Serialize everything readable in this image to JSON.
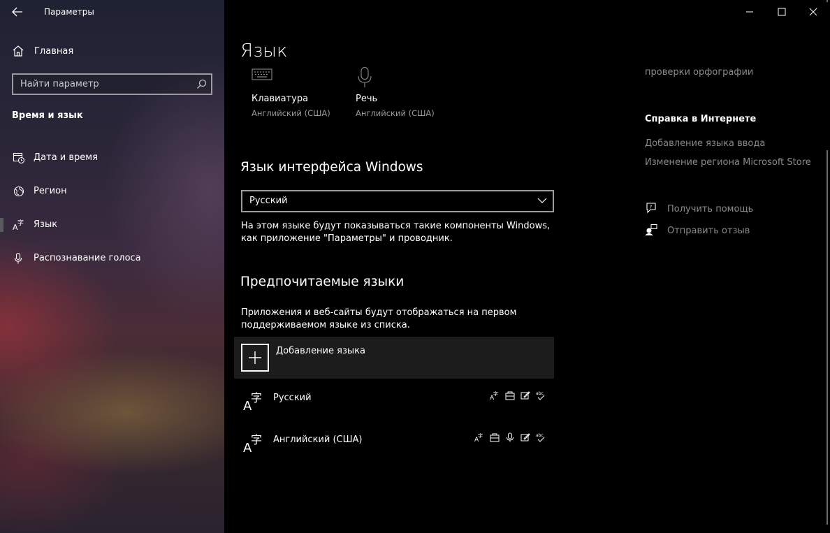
{
  "window": {
    "app_title": "Параметры"
  },
  "sidebar": {
    "home_label": "Главная",
    "search_placeholder": "Найти параметр",
    "section_title": "Время и язык",
    "items": [
      {
        "label": "Дата и время",
        "icon": "calendar-clock-icon"
      },
      {
        "label": "Регион",
        "icon": "globe-icon"
      },
      {
        "label": "Язык",
        "icon": "language-icon",
        "selected": true
      },
      {
        "label": "Распознавание голоса",
        "icon": "microphone-icon"
      }
    ]
  },
  "main": {
    "page_title": "Язык",
    "io_tiles": [
      {
        "title": "Клавиатура",
        "subtitle": "Английский (США)",
        "icon": "keyboard-icon"
      },
      {
        "title": "Речь",
        "subtitle": "Английский (США)",
        "icon": "microphone-icon"
      }
    ],
    "display_language": {
      "heading": "Язык интерфейса Windows",
      "selected": "Русский",
      "description": "На этом языке будут показываться такие компоненты Windows, как приложение \"Параметры\" и проводник."
    },
    "preferred": {
      "heading": "Предпочитаемые языки",
      "description": "Приложения и веб-сайты будут отображаться на первом поддерживаемом языке из списка.",
      "add_label": "Добавление языка",
      "languages": [
        {
          "name": "Русский",
          "features": [
            "display-language-icon",
            "language-pack-icon",
            "handwriting-icon",
            "spellcheck-icon"
          ]
        },
        {
          "name": "Английский (США)",
          "features": [
            "display-language-icon",
            "language-pack-icon",
            "speech-icon",
            "handwriting-icon",
            "spellcheck-icon"
          ]
        }
      ]
    }
  },
  "right_column": {
    "cut_text": "проверки орфографии",
    "online_help_title": "Справка в Интернете",
    "links": [
      "Добавление языка ввода",
      "Изменение региона Microsoft Store"
    ],
    "get_help": "Получить помощь",
    "feedback": "Отправить отзыв"
  },
  "colors": {
    "background": "#000000",
    "dim_text": "#8a8a8a",
    "subtitle_text": "#9b9b9b",
    "add_row_bg": "#1c1c1c"
  }
}
